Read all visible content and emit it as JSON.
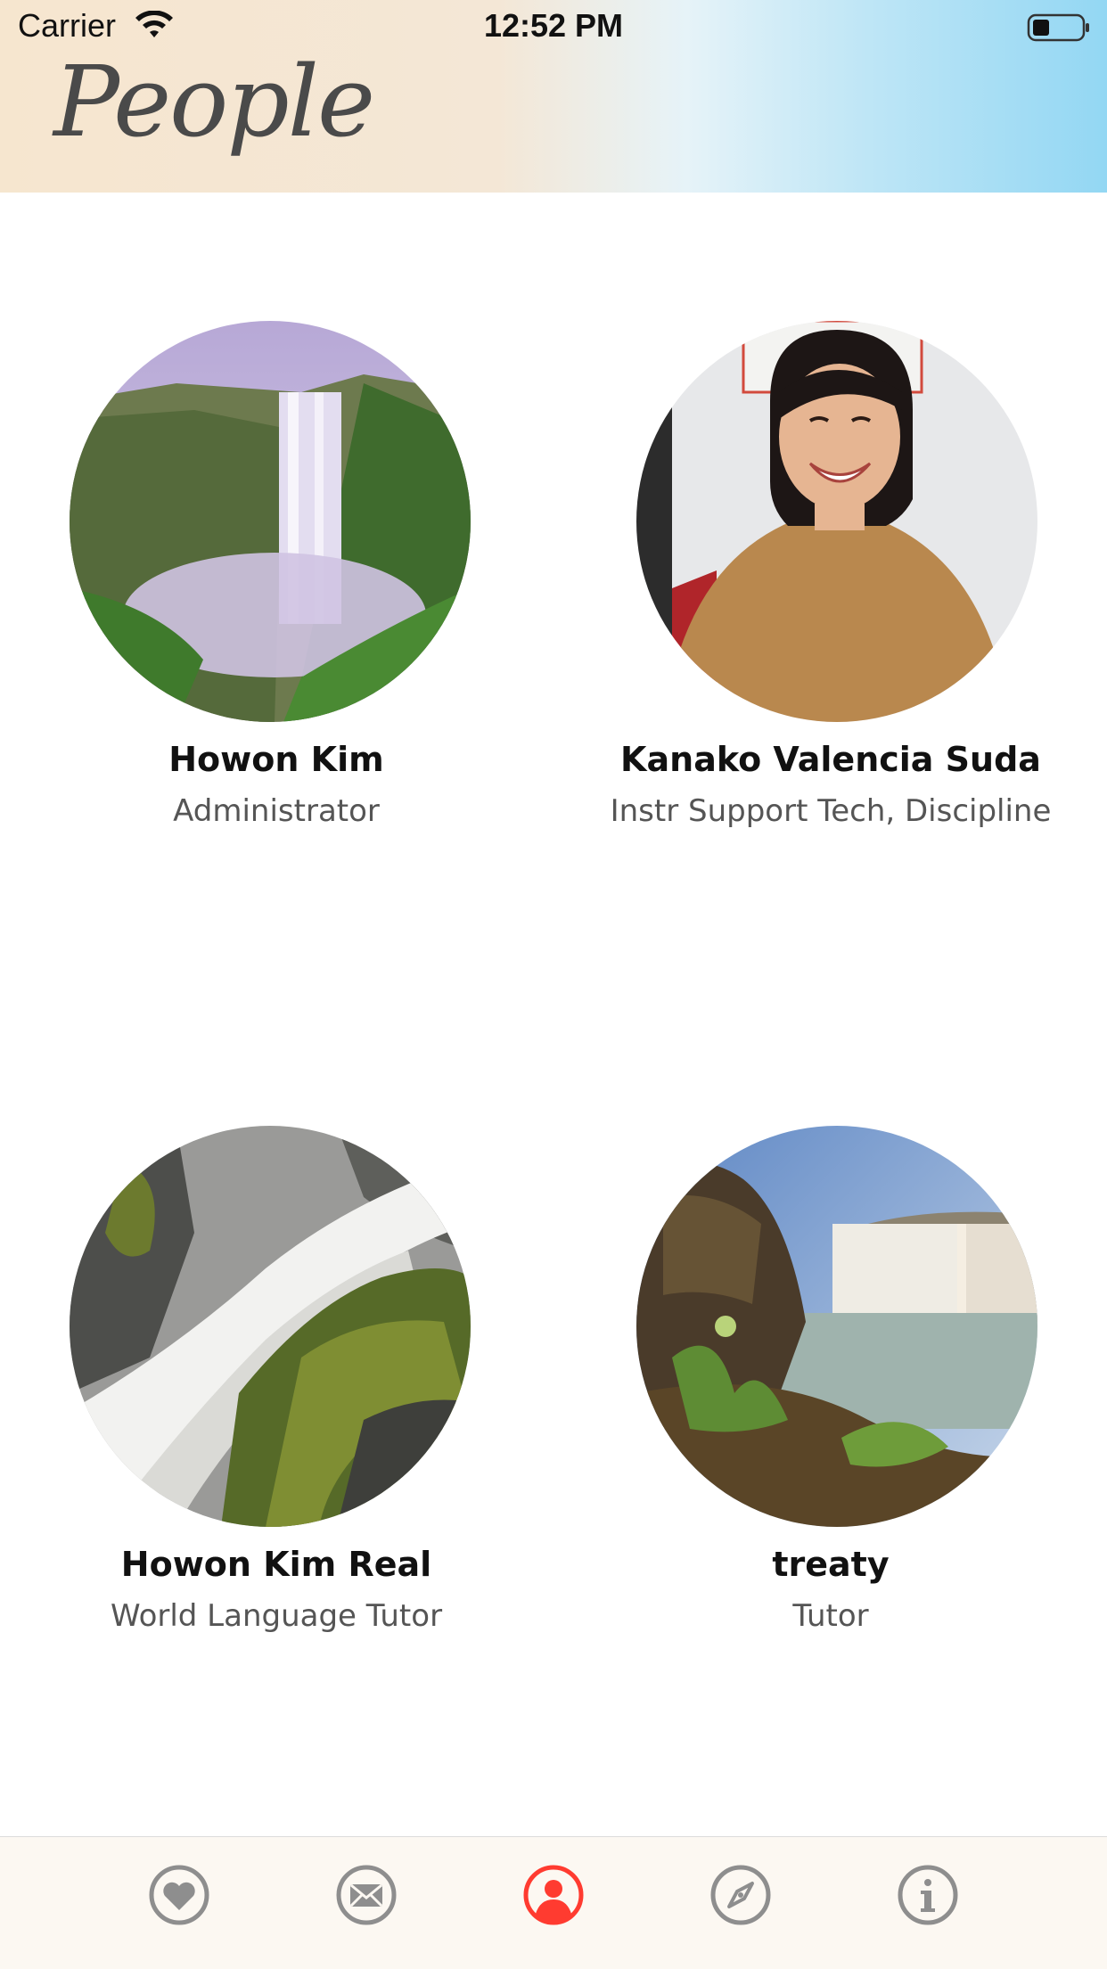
{
  "status_bar": {
    "carrier": "Carrier",
    "time": "12:52 PM"
  },
  "header": {
    "title": "People"
  },
  "people": [
    {
      "name": "Howon Kim",
      "role": "Administrator",
      "avatar": "waterfall-canyon-photo"
    },
    {
      "name": "Kanako Valencia Suda",
      "role": "Instr Support Tech, Discipline",
      "avatar": "portrait-photo"
    },
    {
      "name": "Howon Kim Real",
      "role": "World Language Tutor",
      "avatar": "cascading-waterfall-photo"
    },
    {
      "name": "treaty",
      "role": "Tutor",
      "avatar": "waterfall-shore-photo"
    }
  ],
  "tab_bar": {
    "items": [
      {
        "icon": "heart-icon",
        "selected": false
      },
      {
        "icon": "mail-icon",
        "selected": false
      },
      {
        "icon": "person-icon",
        "selected": true
      },
      {
        "icon": "compass-icon",
        "selected": false
      },
      {
        "icon": "info-icon",
        "selected": false
      }
    ],
    "active_color": "#ff3b30",
    "inactive_color": "#8e8e8e"
  }
}
